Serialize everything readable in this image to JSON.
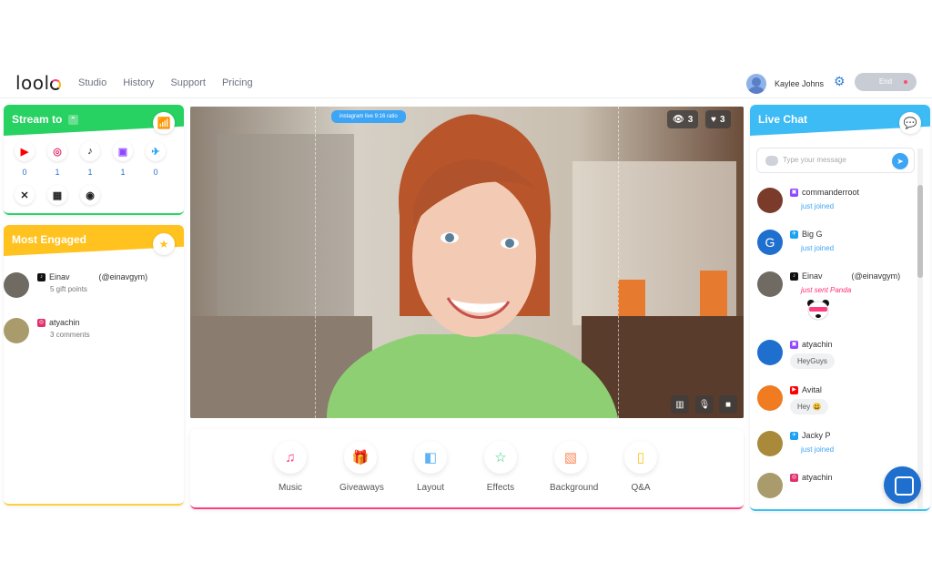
{
  "app": {
    "logo": "loola"
  },
  "nav": {
    "links": [
      "Studio",
      "History",
      "Support",
      "Pricing"
    ]
  },
  "user": {
    "name": "Kaylee Johns",
    "end_label": "End"
  },
  "stream": {
    "title": "Stream to",
    "platforms": [
      {
        "name": "youtube",
        "count": "0",
        "color": "#ff0000"
      },
      {
        "name": "instagram",
        "count": "1",
        "color": "#e1306c"
      },
      {
        "name": "tiktok",
        "count": "1",
        "color": "#111111"
      },
      {
        "name": "twitch",
        "count": "1",
        "color": "#9146ff"
      },
      {
        "name": "twitter",
        "count": "0",
        "color": "#1da1f2"
      }
    ],
    "more_platforms": [
      "pixel-icon",
      "bot-icon",
      "circle-icon"
    ]
  },
  "engaged": {
    "title": "Most Engaged",
    "items": [
      {
        "name": "Einav",
        "handle": "(@einavgym)",
        "sub": "5 gift points",
        "platform": "tiktok"
      },
      {
        "name": "atyachin",
        "handle": "",
        "sub": "3 comments",
        "platform": "instagram"
      }
    ]
  },
  "video": {
    "ratio_badge": "instagram live 9:16 ratio",
    "views": "3",
    "likes": "3"
  },
  "toolbar": {
    "items": [
      {
        "label": "Music",
        "icon": "music-icon",
        "color": "#ff3d7f"
      },
      {
        "label": "Giveaways",
        "icon": "gift-icon",
        "color": "#ff7ac8"
      },
      {
        "label": "Layout",
        "icon": "layout-icon",
        "color": "#5db3f5"
      },
      {
        "label": "Effects",
        "icon": "star-icon",
        "color": "#36d17a"
      },
      {
        "label": "Background",
        "icon": "image-icon",
        "color": "#ff8a5b"
      },
      {
        "label": "Q&A",
        "icon": "qa-icon",
        "color": "#ffc21f"
      }
    ]
  },
  "chat": {
    "title": "Live Chat",
    "placeholder": "Type your message",
    "messages": [
      {
        "name": "commanderroot",
        "text": "just joined",
        "platform": "twitch"
      },
      {
        "name": "Big G",
        "text": "just joined",
        "platform": "twitter"
      },
      {
        "name": "Einav",
        "handle": "(@einavgym)",
        "text": "just sent Panda",
        "platform": "tiktok"
      },
      {
        "name": "atyachin",
        "text": "HeyGuys",
        "platform": "twitch"
      },
      {
        "name": "Avital",
        "text": "Hey 😃",
        "platform": "youtube"
      },
      {
        "name": "Jacky P",
        "text": "just joined",
        "platform": "twitter"
      },
      {
        "name": "atyachin",
        "text": "",
        "platform": "instagram"
      }
    ]
  }
}
